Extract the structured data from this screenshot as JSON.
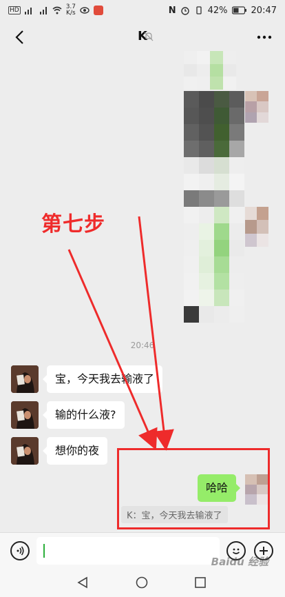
{
  "status_bar": {
    "left_tag": "HD",
    "net_speed_value": "3.7",
    "net_speed_unit": "K/s",
    "battery": "42%",
    "time": "20:47"
  },
  "header": {
    "title": "K"
  },
  "chat": {
    "timestamp": "20:46",
    "messages": [
      {
        "from": "other",
        "text": "宝，今天我去输液了"
      },
      {
        "from": "other",
        "text": "输的什么液?"
      },
      {
        "from": "other",
        "text": "想你的夜"
      },
      {
        "from": "me",
        "text": "哈哈",
        "quote": "K：宝，今天我去输液了"
      }
    ]
  },
  "annotation": {
    "label": "第七步",
    "color": "#ee2b2b"
  },
  "watermark": "Baidu 经验",
  "colors": {
    "background": "#ededed",
    "my_bubble": "#95ec69",
    "other_bubble": "#ffffff"
  }
}
